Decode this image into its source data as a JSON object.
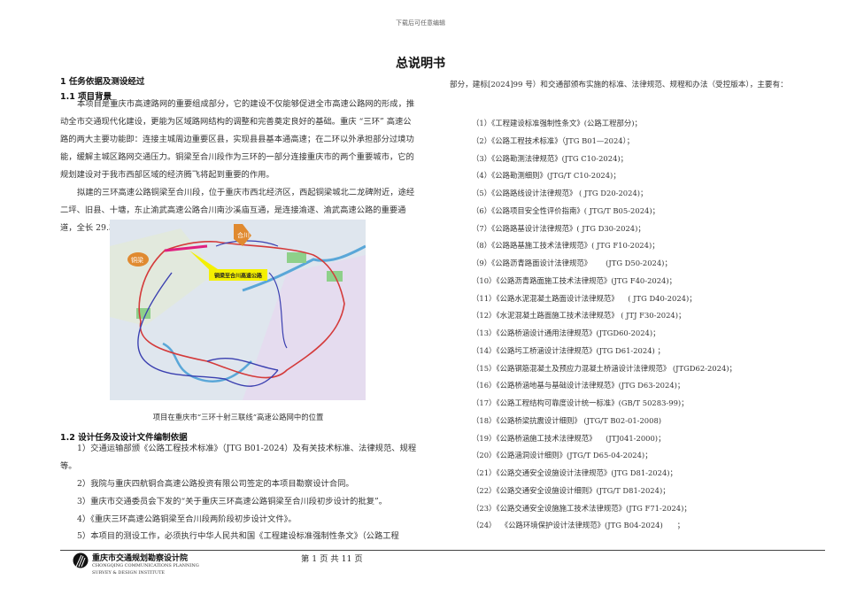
{
  "watermark": "下载后可任意编辑",
  "title": "总说明书",
  "left": {
    "h1": "1 任务依据及测设经过",
    "h11": "1.1 项目背景",
    "p1": "本项目是重庆市高速路网的重要组成部分，它的建设不仅能够促进全市高速公路网的形成，推动全市交通现代化建设，更能为区域路网结构的调整和完善奠定良好的基础。重庆 “三环” 高速公路的两大主要功能即：连接主城周边重要区县，实现县县基本通高速；在二环以外承担部分过境功能，缓解主城区路网交通压力。铜梁至合川段作为三环的一部分连接重庆市的两个重要城市，它的规划建设对于我市西部区域的经济腾飞将起到重要的作用。",
    "p2": "拟建的三环高速公路铜梁至合川段，位于重庆市西北经济区，西起铜梁城北二龙碑附近，途经二坪、旧县、十塘，东止渝武高速公路合川南沙溪庙互通，是连接渝遂、渝武高速公路的重要通道，全长 29.339 公里。",
    "map": {
      "label_route": "铜梁至合川高速公路",
      "label_hechuan": "合川",
      "label_tongliang": "铜梁"
    },
    "caption": "项目在重庆市“三环十射三联线”高速公路网中的位置",
    "h12": "1.2 设计任务及设计文件编制依据",
    "items": [
      "1）交通运输部颁《公路工程技术标准》（JTG B01-2024）及有关技术标准、法律规范、规程等。",
      "2）我院与重庆四航铜合高速公路投资有限公司签定的本项目勘察设计合同。",
      "3）重庆市交通委员会下发的“关于重庆三环高速公路铜梁至合川段初步设计的批复”。",
      "4）《重庆三环高速公路铜梁至合川段两阶段初步设计文件》。",
      "5）本项目的测设工作，必须执行中华人民共和国《工程建设标准强制性条文》（公路工程"
    ]
  },
  "right": {
    "intro": "部分，建标[2024]99 号）和交通部颁布实施的标准、法律规范、规程和办法（受控版本），主要有：",
    "list": [
      "（1）《工程建设标准强制性条文》(公路工程部分)；",
      "（2）《公路工程技术标准》（JTG B01—2024）；",
      "（3）《公路勘测法律规范》(JTG C10-2024)；",
      "（4）《公路勘测细则》(JTG/T C10-2024)；",
      "（5）《公路路线设计法律规范》 ( JTG D20-2024)；",
      "（6）《公路项目安全性评价指南》( JTG/T B05-2024)；",
      "（7）《公路路基设计法律规范》( JTG D30-2024)；",
      "（8）《公路路基施工技术法律规范》( JTG F10-2024)；",
      "（9）《公路沥青路面设计法律规范》      (JTG D50-2024)；",
      "（10）《公路沥青路面施工技术法律规范》(JTG F40-2024)；",
      "（11）《公路水泥混凝土路面设计法律规范》    ( JTG D40-2024)；",
      "（12）《水泥混凝土路面施工技术法律规范》 ( JTJ F30-2024)；",
      "（13）《公路桥涵设计通用法律规范》(JTGD60-2024)；",
      "（14）《公路圬工桥涵设计法律规范》(JTG D61-2024) ；",
      "（15）《公路钢筋混凝土及预应力混凝土桥涵设计法律规范》 (JTGD62-2024)；",
      "（16）《公路桥涵地基与基础设计法律规范》(JTG D63-2024)；",
      "（17）《公路工程结构可靠度设计统一标准》(GB/T 50283-99)；",
      "（18）《公路桥梁抗震设计细则》 (JTG/T B02-01-2008)",
      "（19）《公路桥涵施工技术法律规范》    (JTJ041-2000)；",
      "（20）《公路涵洞设计细则》(JTG/T D65-04-2024)；",
      "（21）《公路交通安全设施设计法律规范》(JTG D81-2024)；",
      "（22）《公路交通安全设施设计细则》(JTG/T D81-2024)；",
      "（23）《公路交通安全设施施工技术法律规范》(JTG F71-2024)；",
      "（24）  《公路环境保护设计法律规范》(JTG B04-2024)      ；"
    ]
  },
  "footer": {
    "org_cn": "重庆市交通规划勘察设计院",
    "org_en1": "CHONGQING COMMUNICATIONS PLANNING",
    "org_en2": "SURVEY & DESIGN INSTITUTE",
    "page": "第 1 页  共 11 页"
  }
}
